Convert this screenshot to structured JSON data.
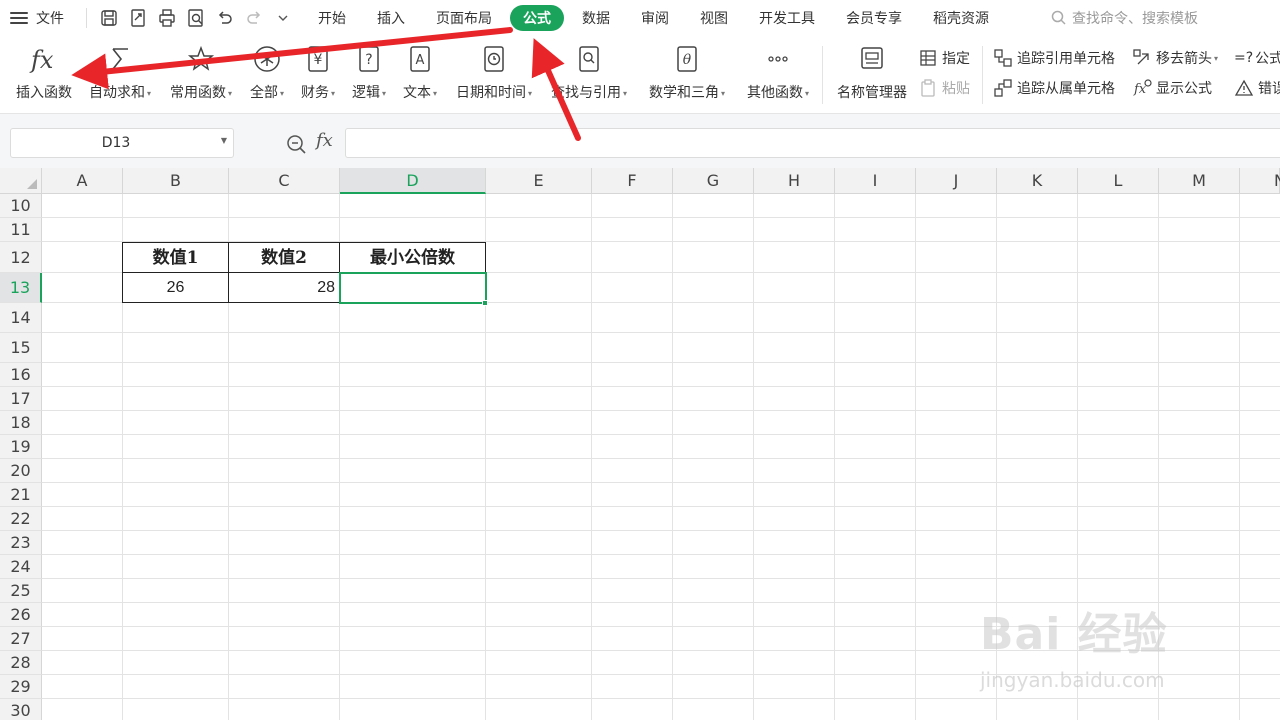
{
  "menubar": {
    "file_label": "文件",
    "tabs": [
      "开始",
      "插入",
      "页面布局",
      "公式",
      "数据",
      "审阅",
      "视图",
      "开发工具",
      "会员专享",
      "稻壳资源"
    ],
    "active_tab": "公式",
    "search_placeholder": "查找命令、搜索模板"
  },
  "ribbon": {
    "insert_function": "插入函数",
    "autosum": "自动求和",
    "common_functions": "常用函数",
    "all": "全部",
    "finance": "财务",
    "logic": "逻辑",
    "text": "文本",
    "datetime": "日期和时间",
    "lookup": "查找与引用",
    "math": "数学和三角",
    "other": "其他函数",
    "name_manager": "名称管理器",
    "specify": "指定",
    "paste": "粘贴",
    "trace_precedents": "追踪引用单元格",
    "trace_dependents": "追踪从属单元格",
    "remove_arrows": "移去箭头",
    "show_formulas": "显示公式",
    "eval_formula": "公式",
    "error_check": "错误"
  },
  "formula_bar": {
    "cell_ref": "D13",
    "fx": "fx",
    "content": ""
  },
  "grid": {
    "columns": [
      "A",
      "B",
      "C",
      "D",
      "E",
      "F",
      "G",
      "H",
      "I",
      "J",
      "K",
      "L",
      "M",
      "N"
    ],
    "rows": [
      "10",
      "11",
      "12",
      "13",
      "14",
      "15",
      "16",
      "17",
      "18",
      "19",
      "20",
      "21",
      "22",
      "23",
      "24",
      "25",
      "26",
      "27",
      "28",
      "29",
      "30"
    ],
    "active_column": "D",
    "active_row": "13"
  },
  "table": {
    "headers": [
      "数值1",
      "数值2",
      "最小公倍数"
    ],
    "row": [
      "26",
      "28",
      ""
    ]
  },
  "watermark": {
    "main": "Bai 经验",
    "sub": "jingyan.baidu.com"
  },
  "colors": {
    "accent": "#1aa35b",
    "arrow": "#e8262a"
  }
}
